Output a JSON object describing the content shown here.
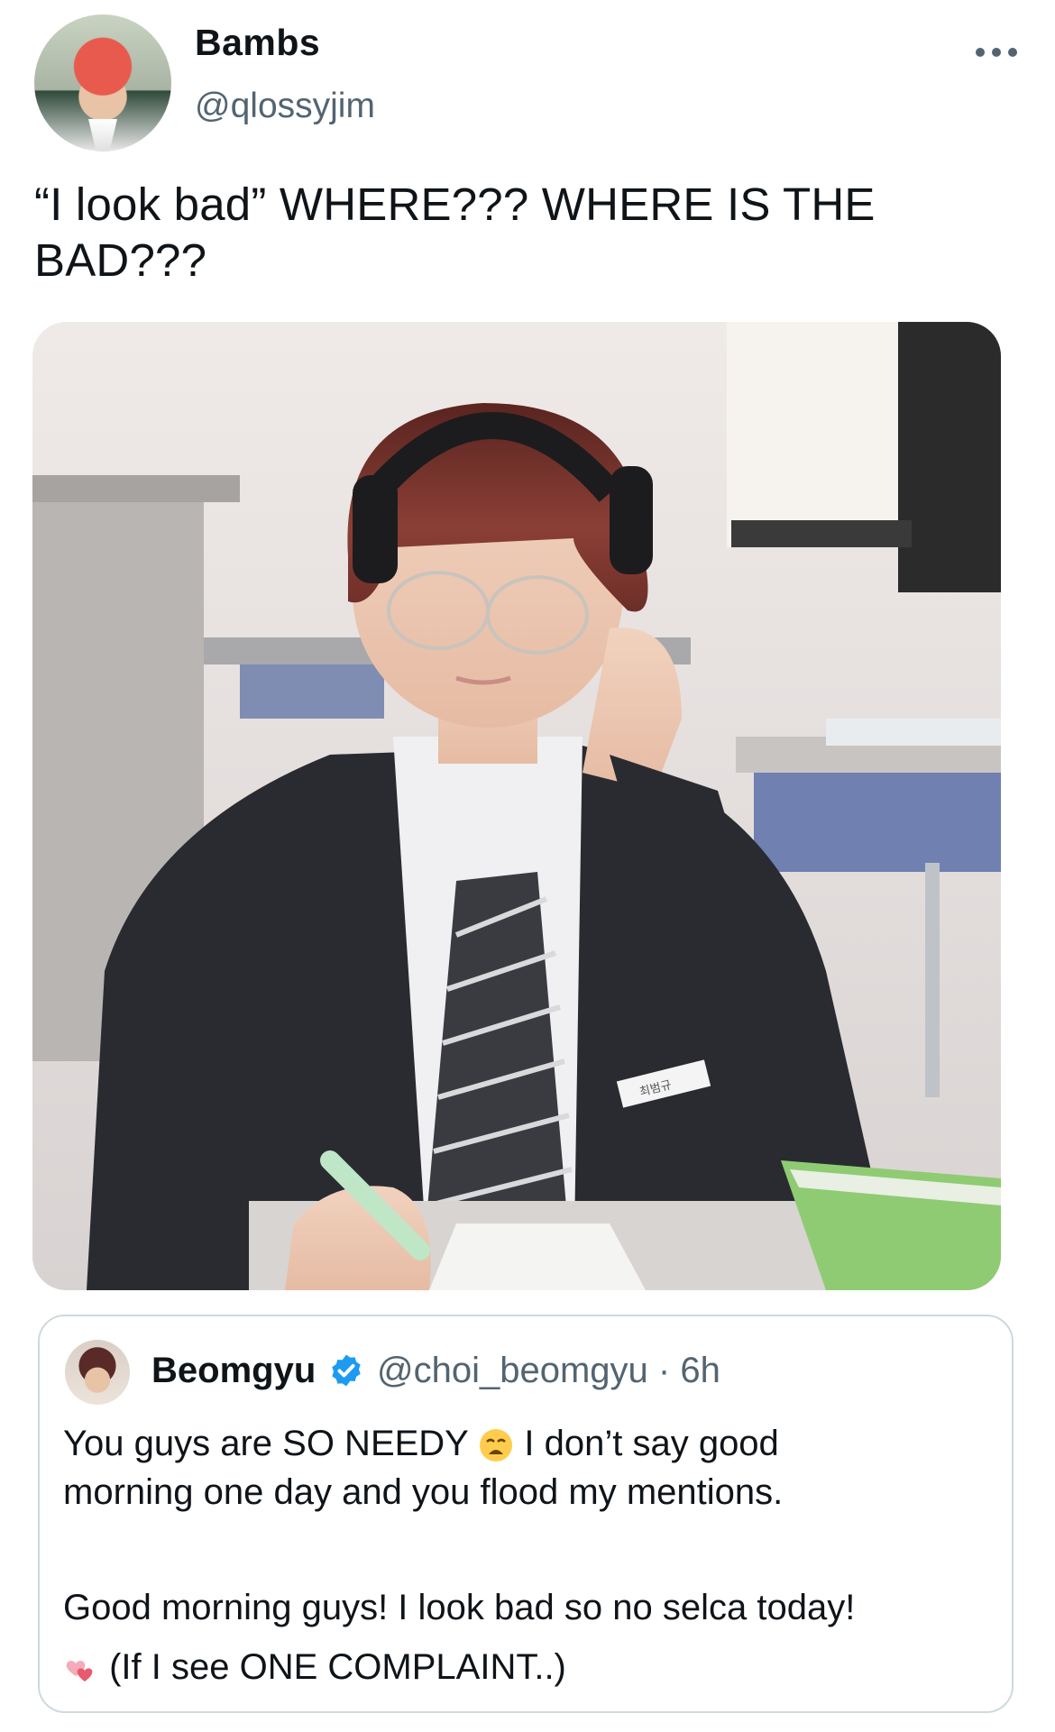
{
  "tweet": {
    "display_name": "Bambs",
    "handle": "@qlossyjim",
    "text": "“I look bad” WHERE??? WHERE IS THE BAD???",
    "more_icon": "more-horizontal-icon"
  },
  "media": {
    "name_tag_text": "최범규"
  },
  "quote": {
    "display_name": "Beomgyu",
    "verified_icon": "verified-badge-icon",
    "handle": "@choi_beomgyu",
    "separator": "·",
    "time": "6h",
    "text_1a": "You guys are SO NEEDY ",
    "emoji_1": "weary-face-emoji",
    "text_1b": " I don’t say good\nmorning one day and you flood my mentions.",
    "text_2": "Good morning guys! I look bad so no selca today!",
    "emoji_2": "two-hearts-emoji",
    "text_3": " (If I see ONE COMPLAINT..)"
  },
  "colors": {
    "text_primary": "#0f1419",
    "text_secondary": "#536471",
    "border": "#cfd9de",
    "verified_blue": "#1d9bf0"
  }
}
